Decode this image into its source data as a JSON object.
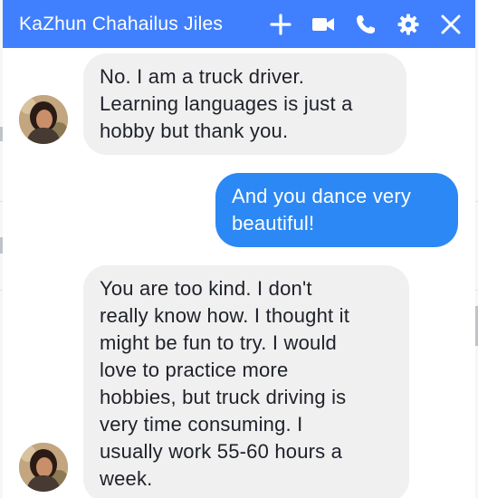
{
  "chat": {
    "title": "KaZhun Chahailus Jiles",
    "icons": [
      "plus-icon",
      "video-camera-icon",
      "phone-icon",
      "gear-icon",
      "close-icon"
    ],
    "colors": {
      "header": "#4080ff",
      "outgoing_bubble": "#2c88f4",
      "incoming_bubble": "#f1f0f0"
    }
  },
  "messages": [
    {
      "sender": "contact",
      "lines": [
        "No. I am a truck driver.",
        "Learning languages is just a",
        "hobby but thank you."
      ]
    },
    {
      "sender": "me",
      "lines": [
        "And you dance very",
        "beautiful!"
      ]
    },
    {
      "sender": "contact",
      "lines": [
        "You are too kind. I don't",
        "really know how. I thought it",
        "might be fun to try. I would",
        "love to practice more",
        "hobbies, but truck driving is",
        "very time consuming. I",
        "usually work 55-60 hours a",
        "week."
      ]
    }
  ]
}
